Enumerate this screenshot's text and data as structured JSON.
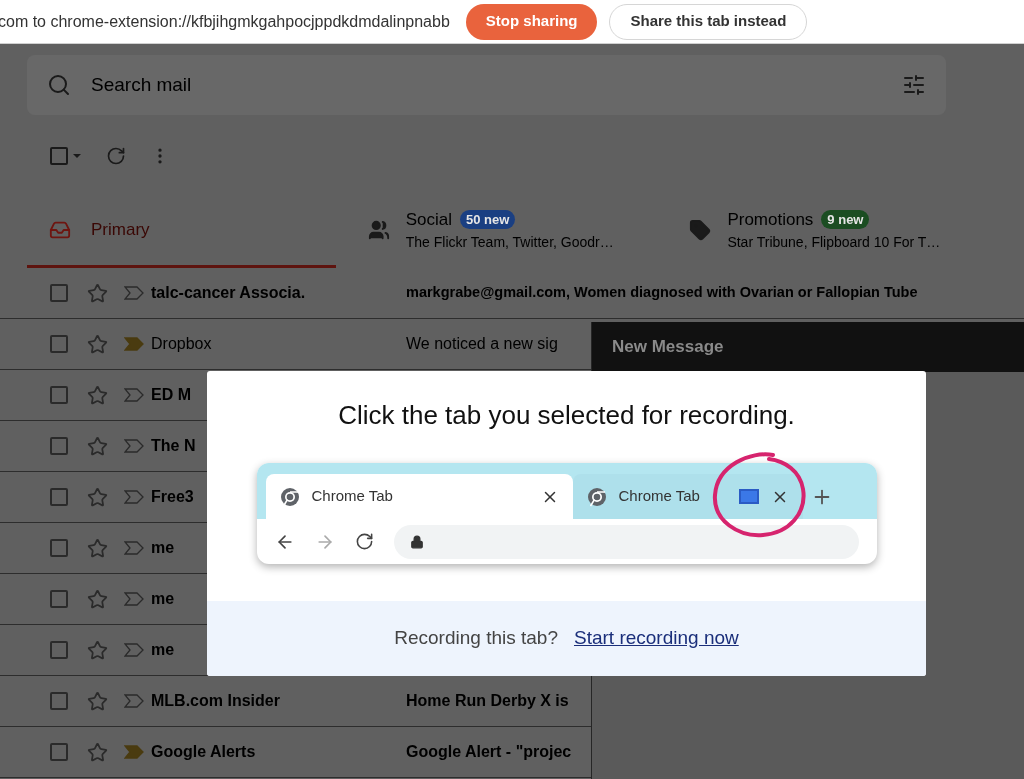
{
  "share_bar": {
    "message": "com to chrome-extension://kfbjihgmkgahpocjppdkdmdalinpnabb",
    "buttons": [
      {
        "label": "Stop sharing",
        "kind": "primary"
      },
      {
        "label": "Share this tab instead",
        "kind": "secondary"
      }
    ]
  },
  "search": {
    "placeholder": "Search mail"
  },
  "toolbar": {
    "select_all_checked": false
  },
  "category_tabs": [
    {
      "kind": "inbox",
      "label": "Primary",
      "selected": true
    },
    {
      "kind": "people",
      "label": "Social",
      "selected": false,
      "badge": "50 new",
      "color": "#1a3f82",
      "senders": "The Flickr Team, Twitter, Goodr…"
    },
    {
      "kind": "tag",
      "label": "Promotions",
      "selected": false,
      "badge": "9 new",
      "color": "#1b4d22",
      "senders": "Star Tribune, Flipboard 10 For T…"
    }
  ],
  "emails": [
    {
      "sender": "talc-cancer Associa.",
      "subject": "markgrabe@gmail.com, Women diagnosed with Ovarian or Fallopian Tube",
      "unread": true,
      "important": false,
      "checked": false,
      "starred": false
    },
    {
      "sender": "Dropbox",
      "subject": "We noticed a new sig",
      "unread": false,
      "important": true,
      "checked": false,
      "starred": false
    },
    {
      "sender": "ED M",
      "unread": true,
      "important": false,
      "checked": false,
      "starred": false
    },
    {
      "sender": "The N",
      "unread": true,
      "important": false,
      "checked": false,
      "starred": false
    },
    {
      "sender": "Free3",
      "unread": true,
      "important": false,
      "checked": false,
      "starred": false
    },
    {
      "sender": "me",
      "unread": true,
      "important": false,
      "checked": false,
      "starred": false
    },
    {
      "sender": "me",
      "unread": true,
      "important": false,
      "checked": false,
      "starred": false
    },
    {
      "sender": "me",
      "unread": true,
      "important": false,
      "checked": false,
      "starred": false
    },
    {
      "sender": "MLB.com Insider",
      "subject": "Home Run Derby X is",
      "unread": true,
      "important": false,
      "checked": false,
      "starred": false
    },
    {
      "sender": "Google Alerts",
      "subject": "Google Alert - \"projec",
      "unread": true,
      "important": true,
      "checked": false,
      "starred": false
    }
  ],
  "compose": {
    "title": "New Message"
  },
  "dialog": {
    "title": "Click the tab you selected for recording.",
    "browser_tabs": [
      {
        "label": "Chrome Tab",
        "selected": true,
        "recording": false
      },
      {
        "label": "Chrome Tab",
        "selected": false,
        "recording": true
      }
    ],
    "question": "Recording this tab?",
    "link": "Start recording now"
  }
}
